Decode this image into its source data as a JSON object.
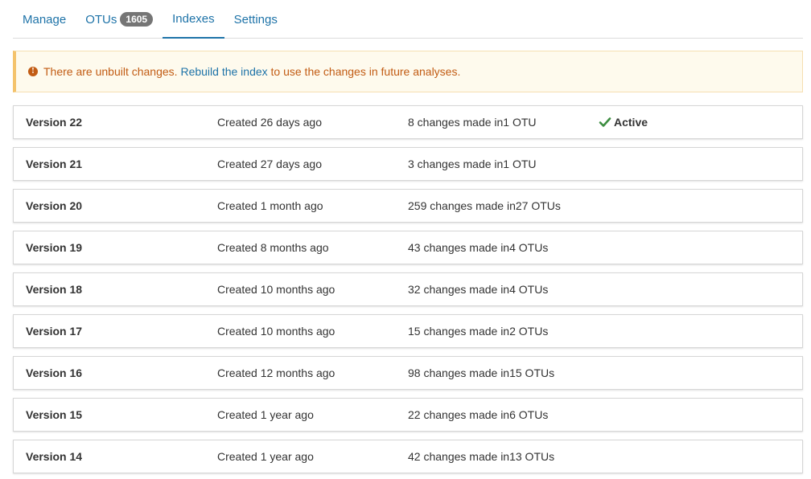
{
  "tabs": [
    {
      "label": "Manage",
      "active": false
    },
    {
      "label": "OTUs",
      "badge": "1605",
      "active": false
    },
    {
      "label": "Indexes",
      "active": true
    },
    {
      "label": "Settings",
      "active": false
    }
  ],
  "alert": {
    "icon": "info-circle-icon",
    "text_before": "There are unbuilt changes. ",
    "link_text": "Rebuild the index",
    "text_after": " to use the changes in future analyses."
  },
  "versions": [
    {
      "version": "Version 22",
      "created": "Created 26 days ago",
      "changes": "8 changes made in1 OTU",
      "active_label": "Active"
    },
    {
      "version": "Version 21",
      "created": "Created 27 days ago",
      "changes": "3 changes made in1 OTU"
    },
    {
      "version": "Version 20",
      "created": "Created 1 month ago",
      "changes": "259 changes made in27 OTUs"
    },
    {
      "version": "Version 19",
      "created": "Created 8 months ago",
      "changes": "43 changes made in4 OTUs"
    },
    {
      "version": "Version 18",
      "created": "Created 10 months ago",
      "changes": "32 changes made in4 OTUs"
    },
    {
      "version": "Version 17",
      "created": "Created 10 months ago",
      "changes": "15 changes made in2 OTUs"
    },
    {
      "version": "Version 16",
      "created": "Created 12 months ago",
      "changes": "98 changes made in15 OTUs"
    },
    {
      "version": "Version 15",
      "created": "Created 1 year ago",
      "changes": "22 changes made in6 OTUs"
    },
    {
      "version": "Version 14",
      "created": "Created 1 year ago",
      "changes": "42 changes made in13 OTUs"
    }
  ],
  "colors": {
    "link": "#1e73a8",
    "warning_text": "#c25c14",
    "warning_bg": "#fefaed",
    "warning_border": "#f4c36c",
    "active_check": "#3c8d40"
  }
}
